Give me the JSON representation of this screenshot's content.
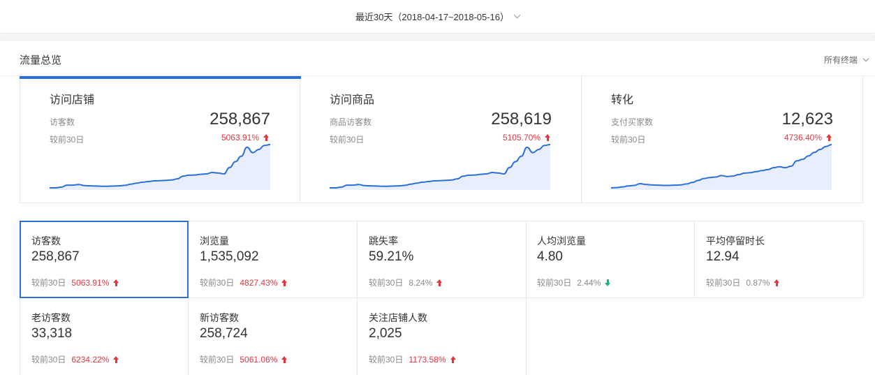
{
  "date_range": {
    "label": "最近30天（2018-04-17~2018-05-16）"
  },
  "section": {
    "title": "流量总览",
    "filter_label": "所有终端"
  },
  "summary_cards": [
    {
      "title": "访问店铺",
      "metric": "访客数",
      "compare": "较前30日",
      "value": "258,867",
      "change": "5063.91%",
      "trend": "up",
      "series": [
        0,
        0,
        1.5,
        6,
        6,
        7.5,
        5,
        4.5,
        4,
        3.5,
        3.5,
        4,
        4.5,
        5.5,
        8,
        10.5,
        12.5,
        14,
        15.5,
        16,
        16.5,
        17.5,
        20,
        26,
        28,
        28.5,
        30,
        31,
        34,
        33,
        31,
        45,
        58,
        70,
        90,
        78,
        85,
        94,
        96
      ]
    },
    {
      "title": "访问商品",
      "metric": "商品访客数",
      "compare": "较前30日",
      "value": "258,619",
      "change": "5105.70%",
      "trend": "up",
      "series": [
        0,
        0,
        1.5,
        6,
        6,
        7.5,
        5,
        4.5,
        4,
        3.5,
        3.5,
        4,
        4.5,
        5.5,
        8,
        10.5,
        12.5,
        14,
        15.5,
        16,
        16.5,
        17.5,
        20,
        26,
        28,
        28.5,
        30,
        31,
        34,
        33,
        31,
        45,
        58,
        70,
        90,
        78,
        85,
        94,
        96
      ]
    },
    {
      "title": "转化",
      "metric": "支付买家数",
      "compare": "较前30日",
      "value": "12,623",
      "change": "4736.40%",
      "trend": "up",
      "series": [
        0,
        0.5,
        2,
        4,
        5,
        8.5,
        7,
        6,
        5.5,
        5,
        5,
        5.5,
        6,
        8,
        11,
        15,
        19,
        21,
        22,
        25,
        23,
        24,
        27,
        30,
        31,
        33,
        35,
        37,
        41,
        43,
        41,
        44,
        55,
        58,
        65,
        72,
        78,
        84,
        88
      ]
    }
  ],
  "metrics": [
    {
      "label": "访客数",
      "value": "258,867",
      "compare": "较前30日",
      "change": "5063.91%",
      "trend": "up",
      "selected": true
    },
    {
      "label": "浏览量",
      "value": "1,535,092",
      "compare": "较前30日",
      "change": "4827.43%",
      "trend": "up",
      "selected": false
    },
    {
      "label": "跳失率",
      "value": "59.21%",
      "compare": "较前30日",
      "change": "8.24%",
      "trend": "up",
      "selected": false
    },
    {
      "label": "人均浏览量",
      "value": "4.80",
      "compare": "较前30日",
      "change": "2.44%",
      "trend": "down",
      "selected": false
    },
    {
      "label": "平均停留时长",
      "value": "12.94",
      "compare": "较前30日",
      "change": "0.87%",
      "trend": "up",
      "selected": false
    },
    {
      "label": "老访客数",
      "value": "33,318",
      "compare": "较前30日",
      "change": "6234.22%",
      "trend": "up",
      "selected": false
    },
    {
      "label": "新访客数",
      "value": "258,724",
      "compare": "较前30日",
      "change": "5061.06%",
      "trend": "up",
      "selected": false
    },
    {
      "label": "关注店铺人数",
      "value": "2,025",
      "compare": "较前30日",
      "change": "1173.58%",
      "trend": "up",
      "selected": false
    }
  ],
  "colors": {
    "accent": "#2b6fd9",
    "up": "#e5333f",
    "down": "#19b37e",
    "spark_fill": "#e8eefb"
  },
  "icons": {
    "dropdown": "chevron-down-icon",
    "up": "arrow-up-icon",
    "down": "arrow-down-icon"
  }
}
